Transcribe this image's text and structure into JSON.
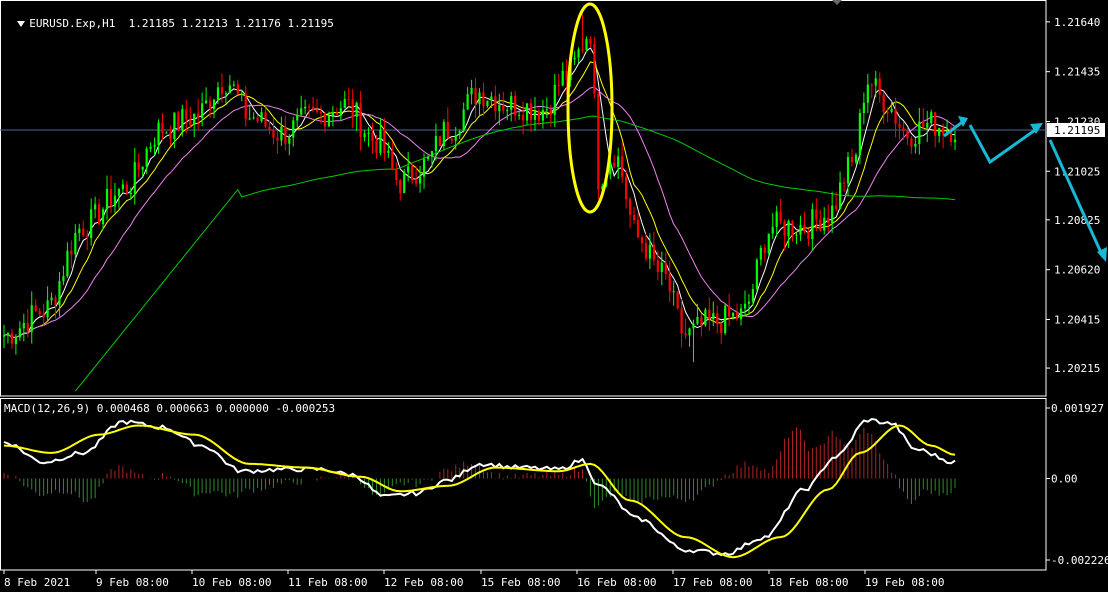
{
  "header": {
    "symbol": "EURUSD.Exp,H1",
    "ohlc": "1.21185 1.21213 1.21176 1.21195"
  },
  "macd_header": "MACD(12,26,9) 0.000468 0.000663 0.000000 -0.000253",
  "colors": {
    "bg": "#000000",
    "bull": "#00ff00",
    "bear": "#ff0000",
    "ma_fast": "#ffffff",
    "ma_mid": "#ffff00",
    "ma_slow": "#ee82ee",
    "ma_long": "#00cc00",
    "macd_line": "#ffffff",
    "signal_line": "#ffff00",
    "hist_pos": "#b22222",
    "hist_neg": "#2e8b2e",
    "annotation_ellipse": "#ffff00",
    "forecast_arrow": "#19b8d6",
    "price_line": "#4a6a9a",
    "axis": "#ffffff"
  },
  "chart_data": [
    {
      "type": "candlestick",
      "title": "EURUSD.Exp,H1",
      "ylim": [
        1.201,
        1.2173
      ],
      "y_ticks": [
        "1.21640",
        "1.21435",
        "1.21230",
        "1.21025",
        "1.20825",
        "1.20620",
        "1.20415",
        "1.20215"
      ],
      "current_price": "1.21195",
      "x_labels": [
        "8 Feb 2021",
        "9 Feb 08:00",
        "10 Feb 08:00",
        "11 Feb 08:00",
        "12 Feb 08:00",
        "15 Feb 08:00",
        "16 Feb 08:00",
        "17 Feb 08:00",
        "18 Feb 08:00",
        "19 Feb 08:00"
      ],
      "close_anchors": [
        [
          0,
          1.2035
        ],
        [
          10,
          1.2045
        ],
        [
          20,
          1.208
        ],
        [
          30,
          1.2095
        ],
        [
          40,
          1.212
        ],
        [
          48,
          1.2125
        ],
        [
          56,
          1.214
        ],
        [
          62,
          1.2125
        ],
        [
          70,
          1.2118
        ],
        [
          78,
          1.2125
        ],
        [
          86,
          1.213
        ],
        [
          94,
          1.2115
        ],
        [
          100,
          1.2098
        ],
        [
          106,
          1.2105
        ],
        [
          112,
          1.212
        ],
        [
          120,
          1.2135
        ],
        [
          128,
          1.213
        ],
        [
          136,
          1.2128
        ],
        [
          142,
          1.2142
        ],
        [
          148,
          1.216
        ],
        [
          150,
          1.21
        ],
        [
          154,
          1.211
        ],
        [
          160,
          1.2075
        ],
        [
          166,
          1.206
        ],
        [
          172,
          1.2035
        ],
        [
          178,
          1.204
        ],
        [
          186,
          1.2043
        ],
        [
          194,
          1.208
        ],
        [
          202,
          1.208
        ],
        [
          208,
          1.2085
        ],
        [
          214,
          1.2105
        ],
        [
          218,
          1.214
        ],
        [
          222,
          1.2132
        ],
        [
          228,
          1.2118
        ],
        [
          234,
          1.2122
        ],
        [
          240,
          1.212
        ]
      ],
      "series": [
        {
          "name": "",
          "kind": "ma",
          "period": 5
        },
        {
          "name": "",
          "kind": "ma",
          "period": 10
        },
        {
          "name": "",
          "kind": "ma",
          "period": 20
        },
        {
          "name": "",
          "kind": "ma",
          "period": 100
        }
      ],
      "annotations": [
        "yellow ellipse around 16 Feb spike",
        "cyan forecast zig-zag arrow"
      ]
    },
    {
      "type": "macd",
      "title": "MACD(12,26,9)",
      "values": {
        "macd": 0.000468,
        "signal": 0.000663,
        "histogram_a": 0.0,
        "histogram_b": -0.000253
      },
      "ylim": [
        -0.002226,
        0.001927
      ],
      "y_ticks": [
        "0.001927",
        "0.00",
        "-0.002226"
      ],
      "macd_anchors": [
        [
          0,
          0.001
        ],
        [
          10,
          0.00045
        ],
        [
          20,
          0.0007
        ],
        [
          30,
          0.00155
        ],
        [
          40,
          0.0014
        ],
        [
          50,
          0.0009
        ],
        [
          60,
          0.0002
        ],
        [
          70,
          0.00025
        ],
        [
          80,
          0.00025
        ],
        [
          88,
          0.0001
        ],
        [
          96,
          -0.0005
        ],
        [
          104,
          -0.0004
        ],
        [
          112,
          -5e-05
        ],
        [
          120,
          0.0004
        ],
        [
          130,
          0.0003
        ],
        [
          140,
          0.00025
        ],
        [
          146,
          0.0005
        ],
        [
          150,
          -0.0002
        ],
        [
          160,
          -0.0011
        ],
        [
          172,
          -0.00195
        ],
        [
          182,
          -0.00205
        ],
        [
          192,
          -0.0016
        ],
        [
          202,
          -0.0003
        ],
        [
          210,
          0.0006
        ],
        [
          218,
          0.0016
        ],
        [
          224,
          0.0015
        ],
        [
          230,
          0.0008
        ],
        [
          240,
          0.00045
        ]
      ],
      "signal_anchors": [
        [
          0,
          0.0009
        ],
        [
          12,
          0.0007
        ],
        [
          24,
          0.0012
        ],
        [
          34,
          0.00145
        ],
        [
          48,
          0.0012
        ],
        [
          62,
          0.0004
        ],
        [
          76,
          0.0003
        ],
        [
          90,
          5e-05
        ],
        [
          100,
          -0.00035
        ],
        [
          112,
          -0.0002
        ],
        [
          124,
          0.0003
        ],
        [
          140,
          0.0002
        ],
        [
          148,
          0.0004
        ],
        [
          158,
          -0.0006
        ],
        [
          172,
          -0.0016
        ],
        [
          184,
          -0.00215
        ],
        [
          196,
          -0.0016
        ],
        [
          208,
          -0.0003
        ],
        [
          216,
          0.0007
        ],
        [
          226,
          0.00145
        ],
        [
          234,
          0.0009
        ],
        [
          240,
          0.00065
        ]
      ]
    }
  ]
}
